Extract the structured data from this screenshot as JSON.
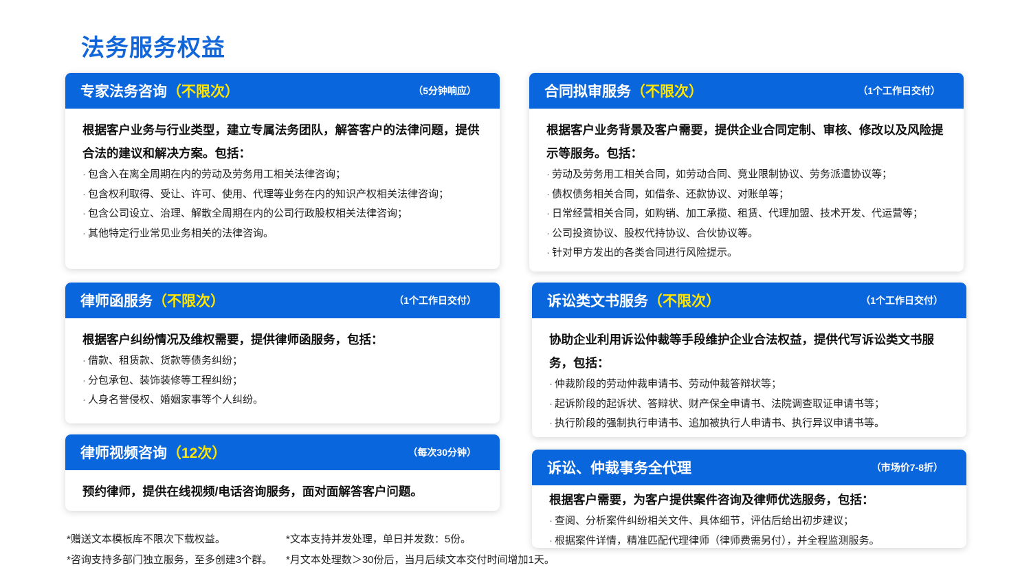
{
  "page": {
    "title": "法务服务权益"
  },
  "cards": [
    {
      "title": "专家法务咨询",
      "quota": "（不限次）",
      "tag": "（5分钟响应）",
      "intro": "根据客户业务与行业类型，建立专属法务团队，解答客户的法律问题，提供合法的建议和解决方案。包括：",
      "items": [
        "包含入在离全周期在内的劳动及劳务用工相关法律咨询；",
        "包含权利取得、受让、许可、使用、代理等业务在内的知识产权相关法律咨询；",
        "包含公司设立、治理、解散全周期在内的公司行政股权相关法律咨询；",
        "其他特定行业常见业务相关的法律咨询。"
      ]
    },
    {
      "title": "合同拟审服务",
      "quota": "（不限次）",
      "tag": "（1个工作日交付）",
      "intro": "根据客户业务背景及客户需要，提供企业合同定制、审核、修改以及风险提示等服务。包括：",
      "items": [
        "劳动及劳务用工相关合同，如劳动合同、竞业限制协议、劳务派遣协议等；",
        "债权债务相关合同，如借条、还款协议、对账单等；",
        "日常经营相关合同，如购销、加工承揽、租赁、代理加盟、技术开发、代运营等；",
        "公司投资协议、股权代持协议、合伙协议等。",
        "针对甲方发出的各类合同进行风险提示。"
      ]
    },
    {
      "title": "律师函服务",
      "quota": "（不限次）",
      "tag": "（1个工作日交付）",
      "intro": "根据客户纠纷情况及维权需要，提供律师函服务，包括：",
      "items": [
        "借款、租赁款、货款等债务纠纷；",
        "分包承包、装饰装修等工程纠纷；",
        "人身名誉侵权、婚姻家事等个人纠纷。"
      ]
    },
    {
      "title": "诉讼类文书服务",
      "quota": "（不限次）",
      "tag": "（1个工作日交付）",
      "intro": "协助企业利用诉讼仲裁等手段维护企业合法权益，提供代写诉讼类文书服务，包括：",
      "items": [
        "仲裁阶段的劳动仲裁申请书、劳动仲裁答辩状等；",
        "起诉阶段的起诉状、答辩状、财产保全申请书、法院调查取证申请书等；",
        "执行阶段的强制执行申请书、追加被执行人申请书、执行异议申请书等。"
      ]
    },
    {
      "title": "律师视频咨询",
      "quota": "（12次）",
      "tag": "（每次30分钟）",
      "intro": "预约律师，提供在线视频/电话咨询服务，面对面解答客户问题。",
      "items": []
    },
    {
      "title": "诉讼、仲裁事务全代理",
      "quota": "",
      "tag": "（市场价7-8折）",
      "intro": "根据客户需要，为客户提供案件咨询及律师优选服务，包括：",
      "items": [
        "查阅、分析案件纠纷相关文件、具体细节，评估后给出初步建议；",
        "根据案件详情，精准匹配代理律师（律师费需另付），并全程监测服务。"
      ]
    }
  ],
  "bullet": "·",
  "footnotes": [
    "*赠送文本模板库不限次下载权益。",
    "*文本支持并发处理，单日并发数：5份。",
    "*咨询支持多部门独立服务，至多创建3个群。",
    "*月文本处理数＞30份后，当月后续文本交付时间增加1天。"
  ],
  "colors": {
    "brand_blue": "#0a66dc",
    "title_blue": "#1266d8",
    "quota_yellow": "#ffe600"
  }
}
